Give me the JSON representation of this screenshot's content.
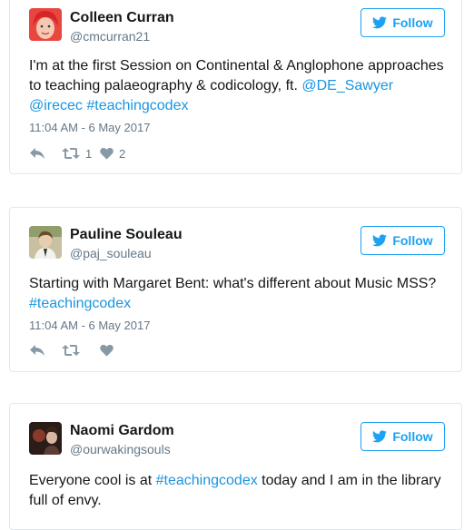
{
  "colors": {
    "accent": "#1da1f2",
    "link": "#1b95e0",
    "muted": "#657786",
    "text": "#14171a",
    "border": "#e1e8ed"
  },
  "follow_label": "Follow",
  "tweets": [
    {
      "name": "Colleen Curran",
      "handle": "@cmcurran21",
      "text_line1": "I'm at the first Session on Continental & Anglophone approaches",
      "text_line2_a": "to teaching palaeography & codicology, ft. ",
      "mention1": "@DE_Sawyer",
      "mention2": "@irecec",
      "hashtag": "#teachingcodex",
      "time": "11:04 AM - 6 May 2017",
      "retweets": "1",
      "likes": "2",
      "icons": [
        "reply-icon",
        "retweet-icon",
        "heart-icon"
      ]
    },
    {
      "name": "Pauline Souleau",
      "handle": "@paj_souleau",
      "text": "Starting with Margaret Bent: what's different about Music MSS?",
      "hashtag": "#teachingcodex",
      "time": "11:04 AM - 6 May 2017",
      "icons": [
        "reply-icon",
        "retweet-icon",
        "heart-icon"
      ]
    },
    {
      "name": "Naomi Gardom",
      "handle": "@ourwakingsouls",
      "text_a": "Everyone cool is at ",
      "hashtag": "#teachingcodex",
      "text_b": " today and I am in the library",
      "text_line2": "full of envy."
    }
  ]
}
